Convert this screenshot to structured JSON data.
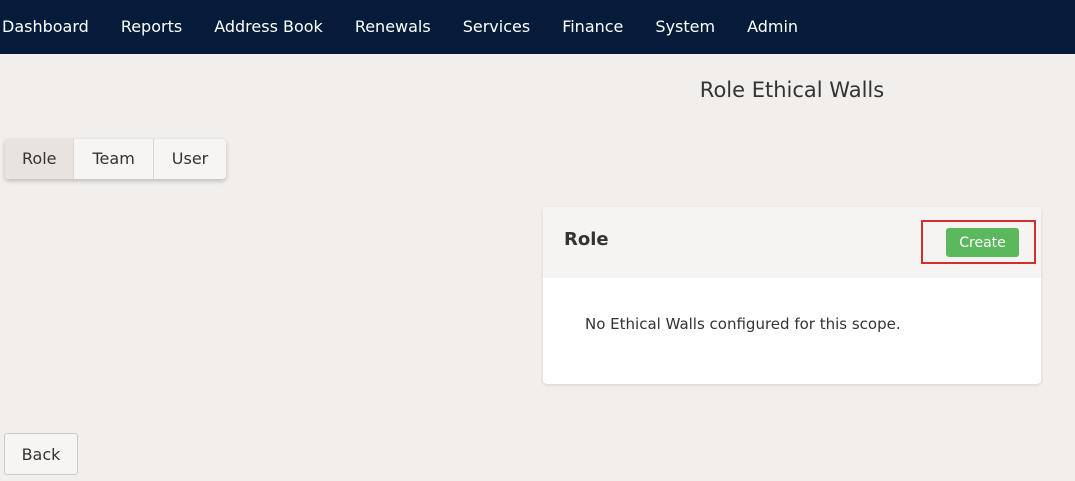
{
  "nav": {
    "items": [
      {
        "label": "Dashboard"
      },
      {
        "label": "Reports"
      },
      {
        "label": "Address Book"
      },
      {
        "label": "Renewals"
      },
      {
        "label": "Services"
      },
      {
        "label": "Finance"
      },
      {
        "label": "System"
      },
      {
        "label": "Admin"
      }
    ]
  },
  "page": {
    "title": "Role Ethical Walls"
  },
  "scope_tabs": {
    "active": "Role",
    "items": [
      {
        "label": "Role"
      },
      {
        "label": "Team"
      },
      {
        "label": "User"
      }
    ]
  },
  "panel": {
    "title": "Role",
    "create_label": "Create",
    "empty_message": "No Ethical Walls configured for this scope."
  },
  "footer": {
    "back_label": "Back"
  },
  "colors": {
    "nav_background": "#041c3a",
    "page_background": "#f2eeeb",
    "create_button": "#5cb85c",
    "highlight_border": "#d32f2f"
  }
}
